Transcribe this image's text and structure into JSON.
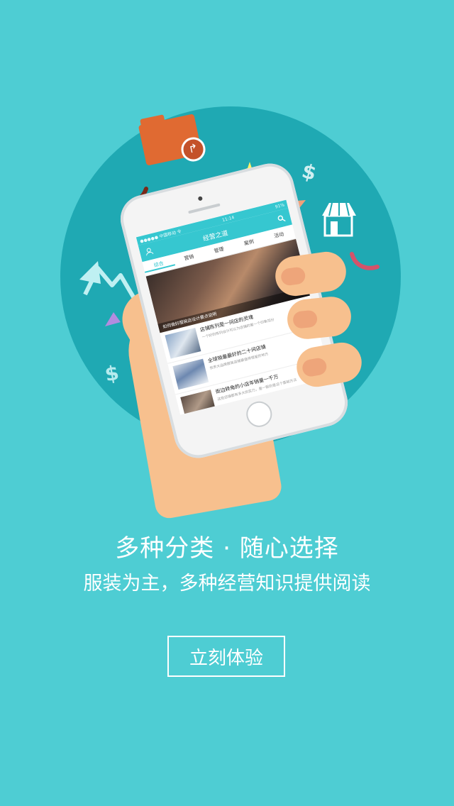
{
  "illustration": {
    "phone": {
      "status_left": "●●●●● 中国移动 令",
      "status_time": "11:14",
      "status_right": "91%",
      "app_title": "经营之道",
      "tabs": [
        "综合",
        "营销",
        "管理",
        "案例",
        "活动"
      ],
      "hero_caption": "如何做好服装店设计要点说明",
      "news": [
        {
          "title": "店铺陈列是一间店的灵魂",
          "desc": "一个好的陈列设计可以为店铺的第一个印象加分"
        },
        {
          "title": "全球销量最好的二十间店铺",
          "desc": "世界大品牌服装店铺最值得借鉴的地方"
        },
        {
          "title": "街边转角的小店年销量一千万",
          "desc": "这些店铺都有多大的实力，是一般的是这个基础方法"
        }
      ]
    },
    "dollar_sign": "$"
  },
  "headline": "多种分类 · 随心选择",
  "subline": "服装为主，多种经营知识提供阅读",
  "cta_label": "立刻体验"
}
